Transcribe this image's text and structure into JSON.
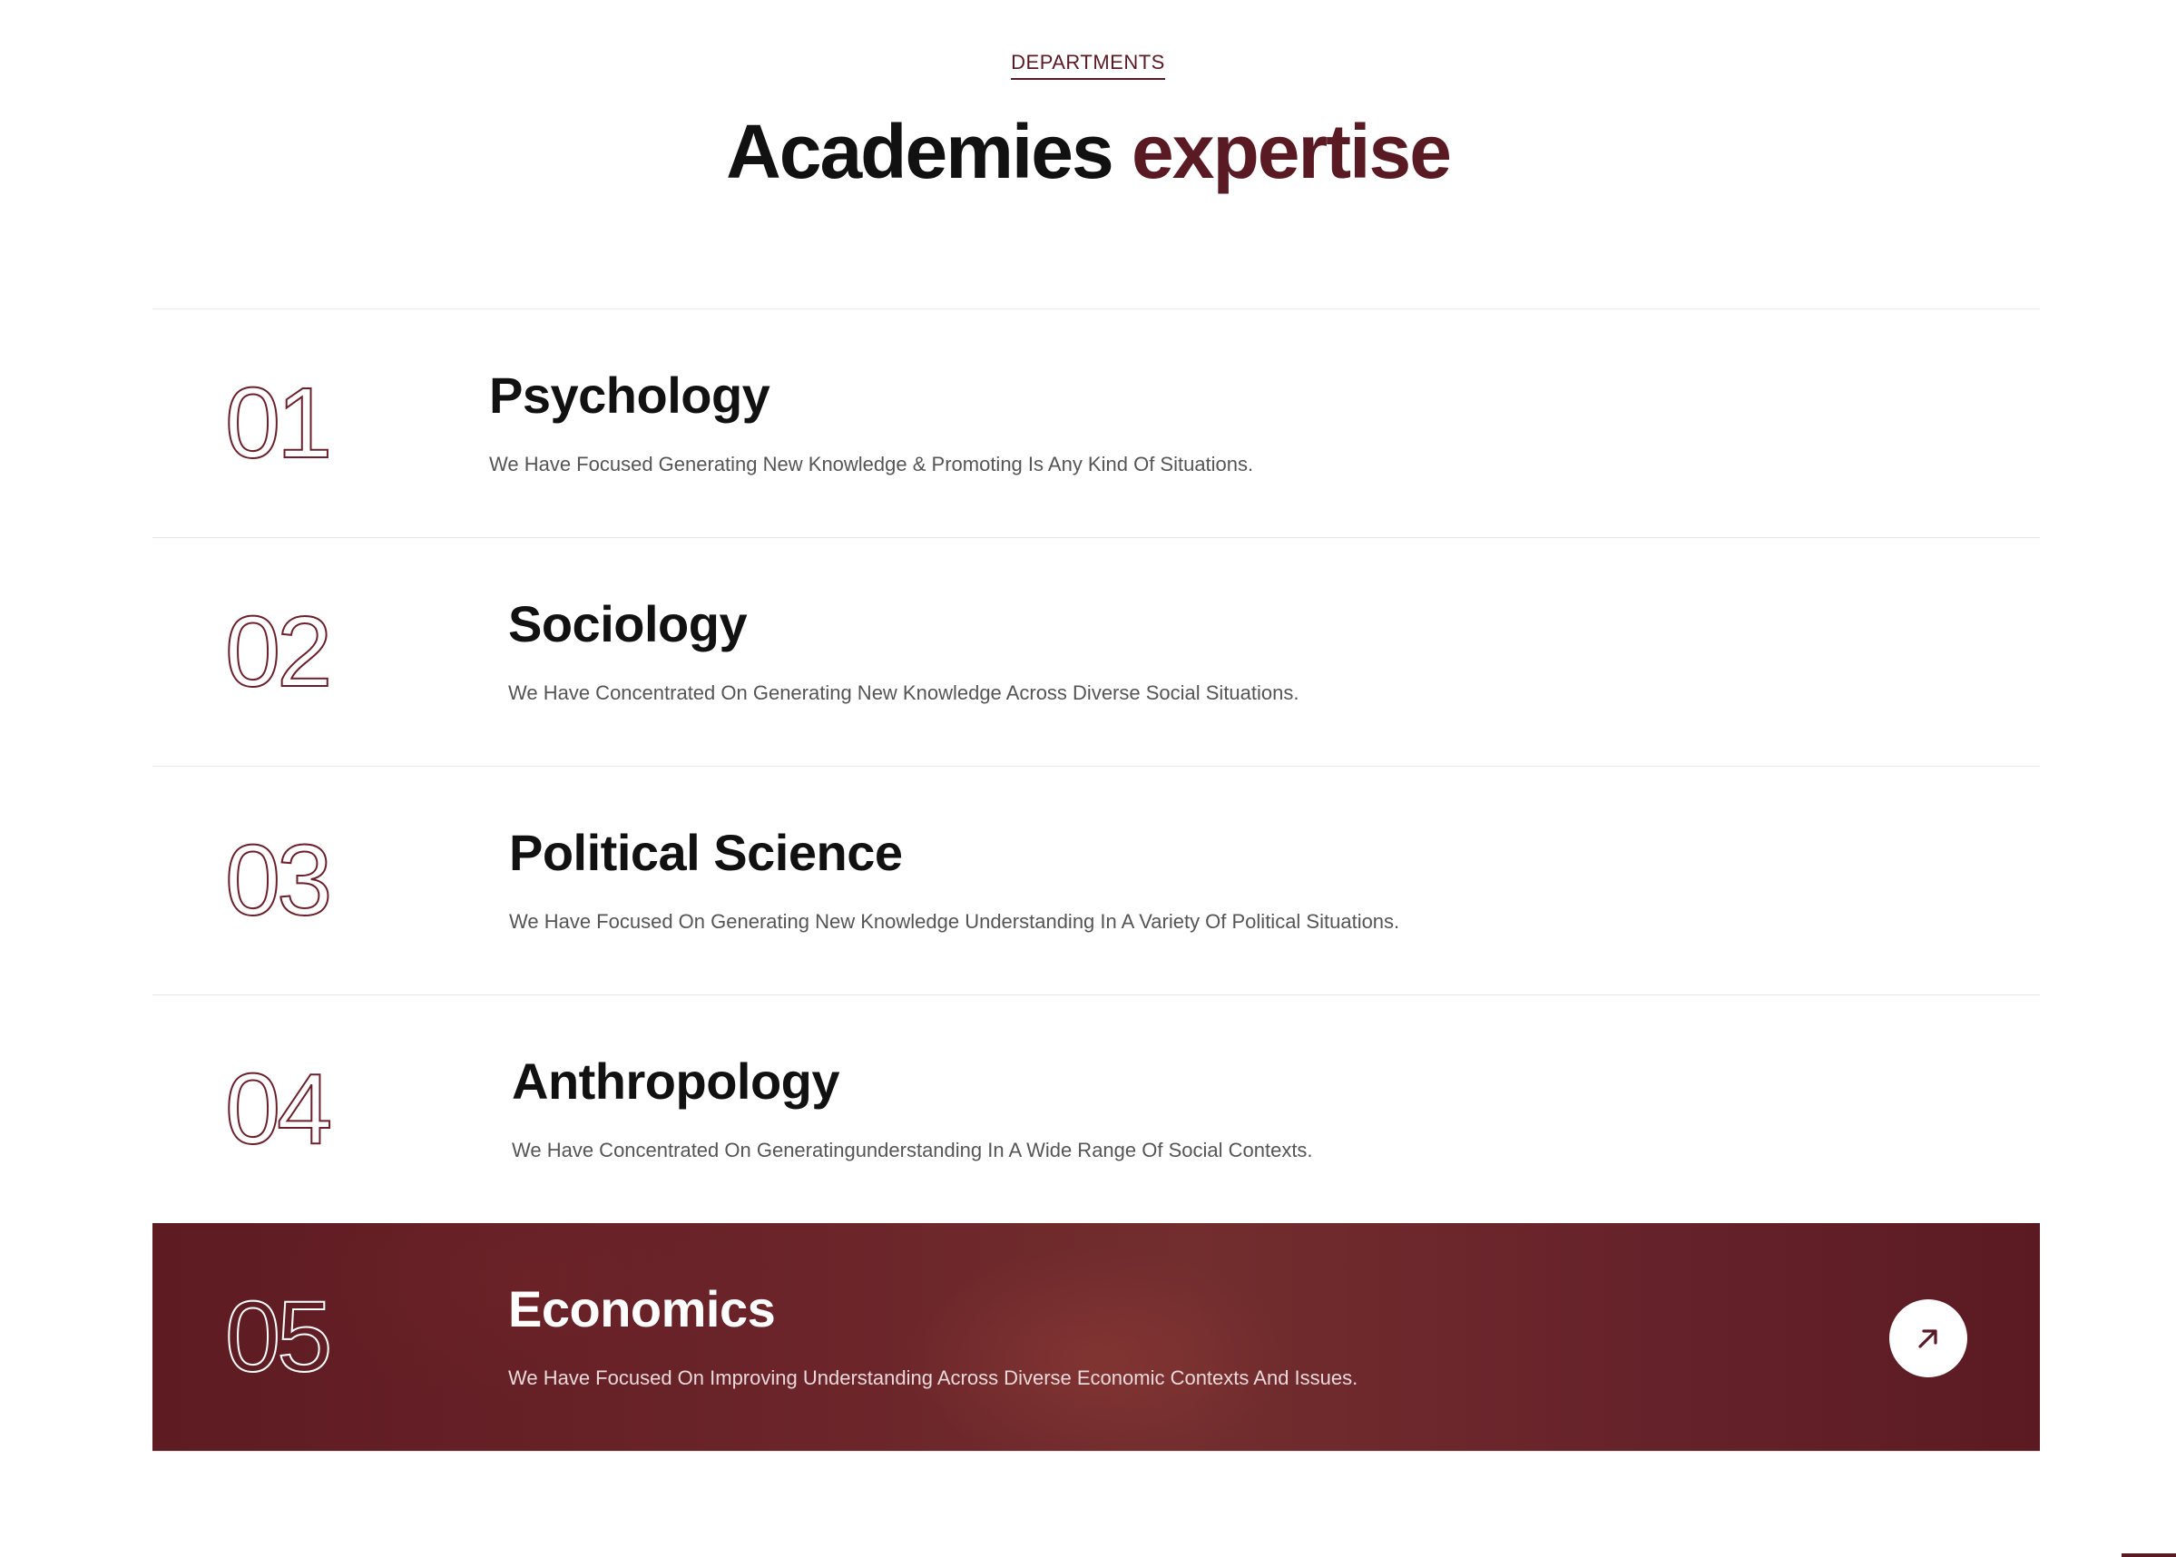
{
  "header": {
    "eyebrow": "DEPARTMENTS",
    "title_main": "Academies",
    "title_accent": "expertise"
  },
  "departments": [
    {
      "number": "01",
      "title": "Psychology",
      "description": "We Have Focused Generating New Knowledge & Promoting Is Any Kind Of Situations."
    },
    {
      "number": "02",
      "title": "Sociology",
      "description": "We Have Concentrated On Generating New Knowledge  Across Diverse Social Situations."
    },
    {
      "number": "03",
      "title": "Political Science",
      "description": "We Have Focused On Generating New Knowledge Understanding In A Variety Of Political Situations."
    },
    {
      "number": "04",
      "title": "Anthropology",
      "description": "We Have Concentrated On Generatingunderstanding In A Wide Range Of Social Contexts."
    },
    {
      "number": "05",
      "title": "Economics",
      "description": "We Have Focused On Improving Understanding Across Diverse Economic Contexts And Issues.",
      "active": true,
      "action_icon": "arrow-up-right-icon"
    }
  ],
  "colors": {
    "accent": "#5a1a24",
    "active_bg": "#6b252a"
  }
}
